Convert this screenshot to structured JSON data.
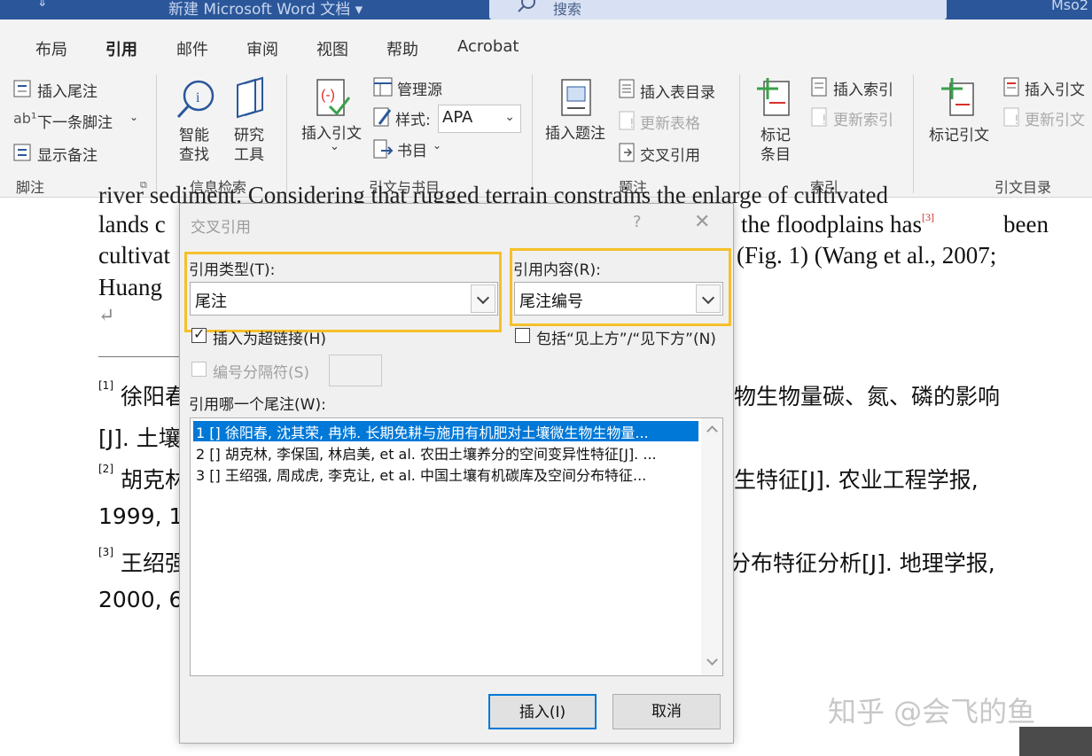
{
  "titlebar": {
    "doc_title": "新建 Microsoft Word 文档 ▾",
    "quick_access": "⇓",
    "search_placeholder": "搜索",
    "user": "Mso2"
  },
  "tabs": [
    {
      "label": "布局"
    },
    {
      "label": "引用",
      "active": true
    },
    {
      "label": "邮件"
    },
    {
      "label": "审阅"
    },
    {
      "label": "视图"
    },
    {
      "label": "帮助"
    },
    {
      "label": "Acrobat"
    }
  ],
  "ribbon": {
    "footnotes": {
      "insert_endnote": "插入尾注",
      "next_footnote": "下一条脚注",
      "show_notes": "显示备注",
      "group": "脚注"
    },
    "research": {
      "smart_lookup": "智能",
      "smart_lookup2": "查找",
      "researcher": "研究",
      "researcher2": "工具",
      "group": "信息检索"
    },
    "citations": {
      "insert_citation": "插入引文",
      "manage_sources": "管理源",
      "style_label": "样式:",
      "style_value": "APA",
      "bibliography": "书目",
      "group": "引文与书目"
    },
    "captions": {
      "insert_caption": "插入题注",
      "insert_table_of_figures": "插入表目录",
      "update_table": "更新表格",
      "cross_reference": "交叉引用",
      "group": "题注"
    },
    "index": {
      "mark_entry": "标记",
      "mark_entry2": "条目",
      "insert_index": "插入索引",
      "update_index": "更新索引",
      "group": "索引"
    },
    "toa": {
      "mark_citation": "标记引文",
      "insert_toa": "插入引文",
      "update_toa": "更新引文",
      "group": "引文目录"
    }
  },
  "document": {
    "line1": "river sediment. Considering that rugged terrain  constrains the enlarge of cultivated",
    "line2a": "lands c",
    "line2b": "the floodplains has",
    "line2_sup": "[3]",
    "line2c": "been",
    "line3a": "cultivat",
    "line3b": "(Fig. 1) (Wang et al., 2007;",
    "line4": "Huang",
    "para_mark": "↵",
    "footnotes": [
      {
        "num": "[1]",
        "left": "徐阳春",
        "right": "物生物量碳、氮、磷的影响",
        "line2": "[J]. 土壤"
      },
      {
        "num": "[2]",
        "left": "胡克林",
        "right": "生特征[J]. 农业工程学报,",
        "line2": "1999, 1"
      },
      {
        "num": "[3]",
        "left": "王绍强",
        "right": "分布特征分析[J]. 地理学报,",
        "line2": "2000, 6"
      }
    ]
  },
  "dialog": {
    "title": "交叉引用",
    "help": "?",
    "close": "✕",
    "ref_type_label": "引用类型(T):",
    "ref_type_value": "尾注",
    "ref_content_label": "引用内容(R):",
    "ref_content_value": "尾注编号",
    "insert_hyperlink": "插入为超链接(H)",
    "include_above_below": "包括“见上方”/“见下方”(N)",
    "separate_numbers": "编号分隔符(S)",
    "which_label": "引用哪一个尾注(W):",
    "items": [
      "1  [] 徐阳春, 沈其荣, 冉炜. 长期免耕与施用有机肥对土壤微生物生物量...",
      "2  [] 胡克林, 李保国, 林启美, et al. 农田土壤养分的空间变异性特征[J]. ...",
      "3  [] 王绍强, 周成虎, 李克让, et al. 中国土壤有机碳库及空间分布特征..."
    ],
    "insert_button": "插入(I)",
    "cancel_button": "取消"
  },
  "watermark": "知乎 @会飞的鱼",
  "colors": {
    "titlebar": "#2b579a",
    "highlight": "#f5c02a",
    "selection": "#0078d7",
    "superscript": "#d9302a"
  }
}
